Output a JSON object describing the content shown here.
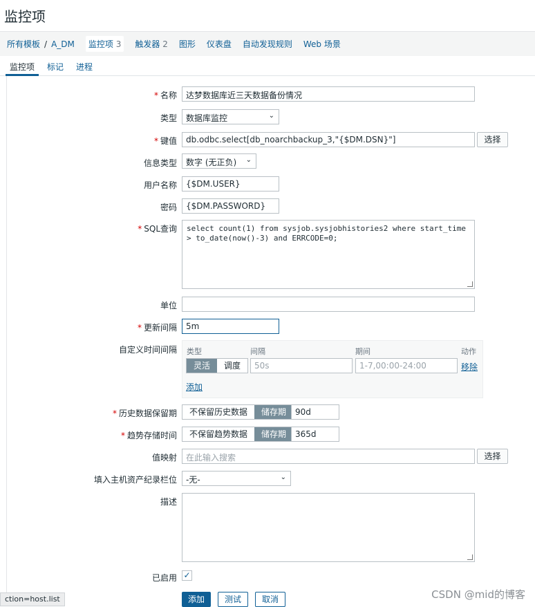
{
  "page_title": "监控项",
  "breadcrumb": {
    "all_templates": "所有模板",
    "separator": "/",
    "template": "A_DM",
    "items": {
      "label": "监控项",
      "count": "3"
    },
    "triggers": {
      "label": "触发器",
      "count": "2"
    },
    "graphs": "图形",
    "dashboards": "仪表盘",
    "discovery": "自动发现规则",
    "web": "Web 场景"
  },
  "tabs": [
    "监控项",
    "标记",
    "进程"
  ],
  "form": {
    "name": {
      "label": "名称",
      "value": "达梦数据库近三天数据备份情况"
    },
    "type": {
      "label": "类型",
      "value": "数据库监控"
    },
    "key": {
      "label": "键值",
      "value": "db.odbc.select[db_noarchbackup_3,\"{$DM.DSN}\"]",
      "button": "选择"
    },
    "info_type": {
      "label": "信息类型",
      "value": "数字 (无正负)"
    },
    "username": {
      "label": "用户名称",
      "value": "{$DM.USER}"
    },
    "password": {
      "label": "密码",
      "value": "{$DM.PASSWORD}"
    },
    "sql": {
      "label": "SQL查询",
      "value": "select count(1) from sysjob.sysjobhistories2 where start_time\n> to_date(now()-3) and ERRCODE=0;"
    },
    "units": {
      "label": "单位",
      "value": ""
    },
    "update_interval": {
      "label": "更新间隔",
      "value": "5m"
    },
    "custom_intervals": {
      "label": "自定义时间间隔",
      "col_type": "类型",
      "col_interval": "间隔",
      "col_period": "期间",
      "col_action": "动作",
      "type_flexible": "灵活",
      "type_scheduling": "调度",
      "interval_placeholder": "50s",
      "period_placeholder": "1-7,00:00-24:00",
      "remove": "移除",
      "add": "添加"
    },
    "history": {
      "label": "历史数据保留期",
      "opt_off": "不保留历史数据",
      "opt_on": "储存期",
      "value": "90d"
    },
    "trends": {
      "label": "趋势存储时间",
      "opt_off": "不保留趋势数据",
      "opt_on": "储存期",
      "value": "365d"
    },
    "valuemap": {
      "label": "值映射",
      "placeholder": "在此输入搜索",
      "button": "选择"
    },
    "inventory": {
      "label": "填入主机资产纪录栏位",
      "value": "-无-"
    },
    "description": {
      "label": "描述",
      "value": ""
    },
    "enabled": {
      "label": "已启用",
      "checked": true
    }
  },
  "buttons": {
    "add": "添加",
    "test": "测试",
    "cancel": "取消"
  },
  "status_url": "ction=host.list",
  "watermark": "CSDN @mid的博客"
}
